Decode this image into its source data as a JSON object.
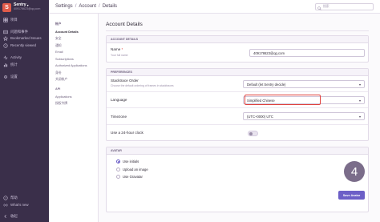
{
  "org": {
    "initial": "S",
    "name": "Sentry",
    "email": "409178623@qq.com"
  },
  "sidebar": {
    "items": [
      {
        "label": "项目",
        "icon": "projects-icon"
      },
      {
        "label": "问题和事件",
        "icon": "issues-icon"
      },
      {
        "label": "Bookmarked Issues",
        "icon": "star-icon"
      },
      {
        "label": "Recently viewed",
        "icon": "clock-icon"
      },
      {
        "label": "Activity",
        "icon": "activity-icon"
      },
      {
        "label": "统计",
        "icon": "stats-icon"
      },
      {
        "label": "设置",
        "icon": "gear-icon"
      }
    ],
    "bottom": [
      {
        "label": "帮助",
        "icon": "help-icon"
      },
      {
        "label": "What's new",
        "icon": "broadcast-icon"
      },
      {
        "label": "收起",
        "icon": "collapse-icon"
      }
    ]
  },
  "breadcrumb": {
    "items": [
      "Settings",
      "Account",
      "Details"
    ]
  },
  "search": {
    "placeholder": "搜索"
  },
  "subnav": {
    "account_header": "帐户",
    "account_items": [
      "Account Details",
      "安全",
      "通知",
      "Email",
      "Subscriptions",
      "Authorized Applications",
      "身份",
      "关闭帐户"
    ],
    "api_header": "API",
    "api_items": [
      "Applications",
      "授权令牌"
    ]
  },
  "main": {
    "title": "Account Details",
    "account_panel": {
      "header": "ACCOUNT DETAILS",
      "name_label": "Name",
      "name_help": "Your full name",
      "name_value": "409178623@qq.com"
    },
    "prefs_panel": {
      "header": "PREFERENCES",
      "stacktrace_label": "Stacktrace Order",
      "stacktrace_help": "Choose the default ordering of frames in stacktraces",
      "stacktrace_value": "Default (let Sentry decide)",
      "language_label": "Language",
      "language_value": "Simplified Chinese",
      "timezone_label": "Timezone",
      "timezone_value": "(UTC+0000) UTC",
      "clock_label": "Use a 24-hour clock"
    },
    "avatar_panel": {
      "header": "AVATAR",
      "options": [
        "Use initials",
        "Upload an image",
        "Use Gravatar"
      ],
      "selected_index": 0,
      "avatar_initial": "4",
      "save_label": "Save Avatar"
    },
    "colors": {
      "accent": "#6c5fc7",
      "sidebar": "#3a2f4a",
      "highlight": "#e0413d"
    }
  }
}
